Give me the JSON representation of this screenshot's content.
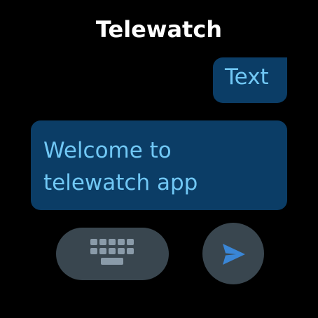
{
  "app": {
    "title": "Telewatch"
  },
  "messages": [
    {
      "direction": "outgoing",
      "text": "Text"
    },
    {
      "direction": "incoming",
      "text": "Welcome to telewatch app"
    }
  ],
  "controls": {
    "keyboard_icon": "keyboard-icon",
    "send_icon": "send-icon"
  },
  "colors": {
    "background": "#000000",
    "bubble": "#0b3d66",
    "bubble_text": "#71c8f5",
    "button": "#39464f",
    "keyboard_icon": "#8a9ba9",
    "send_icon": "#3a86d6"
  }
}
